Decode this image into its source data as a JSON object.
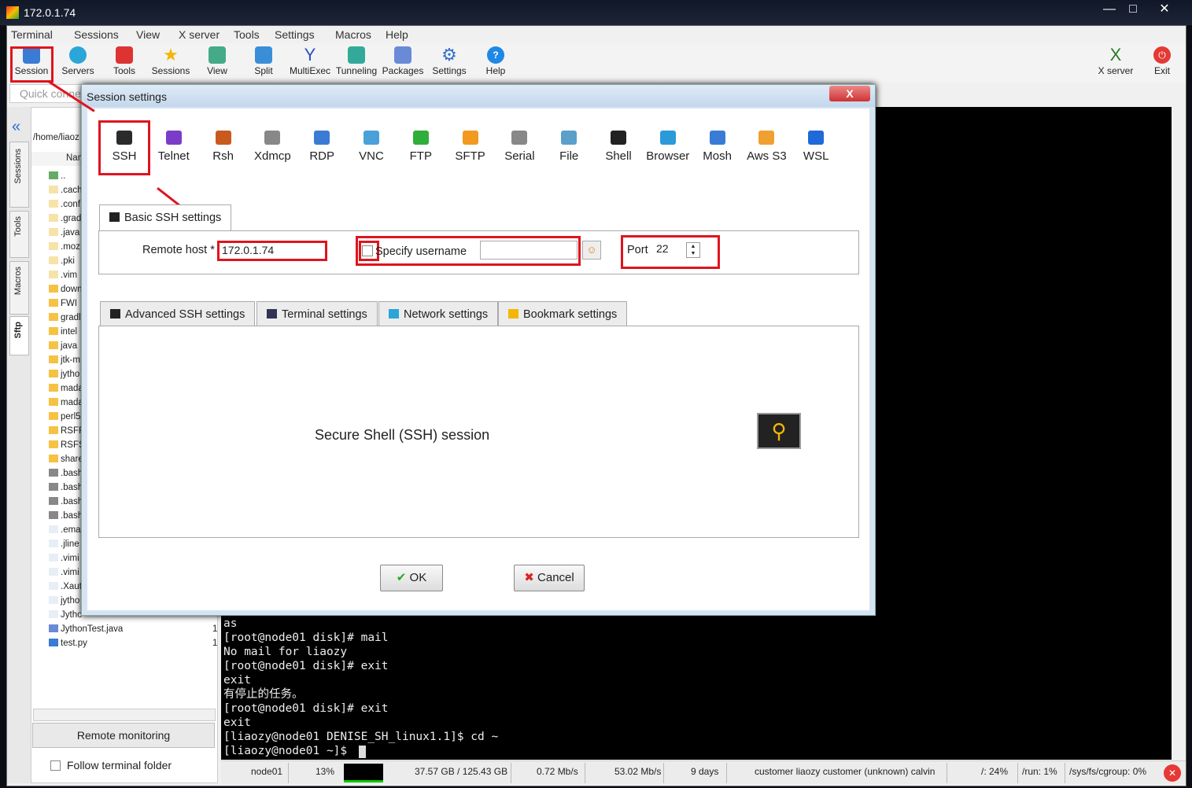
{
  "window": {
    "title": "172.0.1.74"
  },
  "menu": [
    "Terminal",
    "Sessions",
    "View",
    "X server",
    "Tools",
    "Settings",
    "Macros",
    "Help"
  ],
  "toolbar": [
    {
      "label": "Session",
      "icon": "monitor-session-icon",
      "color": "#3a7bd5"
    },
    {
      "label": "Servers",
      "icon": "servers-icon",
      "color": "#2aa6d8"
    },
    {
      "label": "Tools",
      "icon": "tools-icon",
      "color": "#d33"
    },
    {
      "label": "Sessions",
      "icon": "star-icon",
      "color": "#f2b705"
    },
    {
      "label": "View",
      "icon": "view-icon",
      "color": "#4a8"
    },
    {
      "label": "Split",
      "icon": "split-icon",
      "color": "#3a8ed8"
    },
    {
      "label": "MultiExec",
      "icon": "multiexec-icon",
      "color": "#3050c0"
    },
    {
      "label": "Tunneling",
      "icon": "tunneling-icon",
      "color": "#3a9"
    },
    {
      "label": "Packages",
      "icon": "packages-icon",
      "color": "#6a8ad8"
    },
    {
      "label": "Settings",
      "icon": "gear-icon",
      "color": "#3070c8"
    },
    {
      "label": "Help",
      "icon": "help-icon",
      "color": "#1e88e5"
    }
  ],
  "toolbar_right": [
    {
      "label": "X server",
      "icon": "x-server-icon"
    },
    {
      "label": "Exit",
      "icon": "power-icon"
    }
  ],
  "quick_connect": {
    "placeholder": "Quick conne"
  },
  "side_tabs": [
    "Sessions",
    "Tools",
    "Macros",
    "Sftp"
  ],
  "files": {
    "path": "/home/liaoz",
    "column": "Name",
    "items": [
      {
        "name": "..",
        "type": "up"
      },
      {
        "name": ".cach",
        "type": "hidden-folder"
      },
      {
        "name": ".conf",
        "type": "hidden-folder"
      },
      {
        "name": ".grad",
        "type": "hidden-folder"
      },
      {
        "name": ".java",
        "type": "hidden-folder"
      },
      {
        "name": ".moz",
        "type": "hidden-folder"
      },
      {
        "name": ".pki",
        "type": "hidden-folder"
      },
      {
        "name": ".vim",
        "type": "hidden-folder"
      },
      {
        "name": "down",
        "type": "folder"
      },
      {
        "name": "FWI",
        "type": "folder"
      },
      {
        "name": "gradl",
        "type": "folder"
      },
      {
        "name": "intel",
        "type": "folder"
      },
      {
        "name": "java",
        "type": "folder"
      },
      {
        "name": "jtk-m",
        "type": "folder"
      },
      {
        "name": "jytho",
        "type": "folder"
      },
      {
        "name": "mada",
        "type": "folder"
      },
      {
        "name": "mada",
        "type": "folder"
      },
      {
        "name": "perl5",
        "type": "folder"
      },
      {
        "name": "RSFR",
        "type": "folder"
      },
      {
        "name": "RSFS",
        "type": "folder"
      },
      {
        "name": "share",
        "type": "folder"
      },
      {
        "name": ".bash",
        "type": "file-dark"
      },
      {
        "name": ".bash",
        "type": "file-dark"
      },
      {
        "name": ".bash",
        "type": "file-dark"
      },
      {
        "name": ".bash",
        "type": "file-dark"
      },
      {
        "name": ".ema",
        "type": "file"
      },
      {
        "name": ".jline",
        "type": "file"
      },
      {
        "name": ".vimi",
        "type": "file"
      },
      {
        "name": ".vimi",
        "type": "file"
      },
      {
        "name": ".Xaut",
        "type": "file"
      },
      {
        "name": "jytho",
        "type": "file"
      },
      {
        "name": "Jytho",
        "type": "file"
      },
      {
        "name": "JythonTest.java",
        "type": "java",
        "size": "1"
      },
      {
        "name": "test.py",
        "type": "python",
        "size": "1"
      }
    ]
  },
  "remote_monitoring": "Remote monitoring",
  "follow_terminal": "Follow terminal folder",
  "terminal": [
    "as",
    "[root@node01 disk]# mail",
    "No mail for liaozy",
    "[root@node01 disk]# exit",
    "exit",
    "有停止的任务。",
    "[root@node01 disk]# exit",
    "exit",
    "[liaozy@node01 DENISE_SH_linux1.1]$ cd ~",
    "[liaozy@node01 ~]$ "
  ],
  "status": {
    "host": "node01",
    "cpu": "13%",
    "memory": "37.57 GB / 125.43 GB",
    "upload": "0.72 Mb/s",
    "download": "53.02 Mb/s",
    "uptime": "9 days",
    "users": "customer  liaozy  customer  (unknown)  calvin",
    "disk_root": "/: 24%",
    "disk_run": "/run: 1%",
    "disk_cgroup": "/sys/fs/cgroup: 0%"
  },
  "dialog": {
    "title": "Session settings",
    "close": "X",
    "protocols": [
      {
        "label": "SSH",
        "color": "#2b2b2b"
      },
      {
        "label": "Telnet",
        "color": "#7a3cc8"
      },
      {
        "label": "Rsh",
        "color": "#c85a1e"
      },
      {
        "label": "Xdmcp",
        "color": "#888"
      },
      {
        "label": "RDP",
        "color": "#3a7bd5"
      },
      {
        "label": "VNC",
        "color": "#4aa0d8"
      },
      {
        "label": "FTP",
        "color": "#2fae3a"
      },
      {
        "label": "SFTP",
        "color": "#f39a1e"
      },
      {
        "label": "Serial",
        "color": "#888"
      },
      {
        "label": "File",
        "color": "#5aa0c8"
      },
      {
        "label": "Shell",
        "color": "#222"
      },
      {
        "label": "Browser",
        "color": "#2a9ad8"
      },
      {
        "label": "Mosh",
        "color": "#3a7bd5"
      },
      {
        "label": "Aws S3",
        "color": "#f0a030"
      },
      {
        "label": "WSL",
        "color": "#1e6ad8"
      }
    ],
    "basic_tab": "Basic SSH settings",
    "remote_host_label": "Remote host *",
    "remote_host": "172.0.1.74",
    "specify_username": "Specify username",
    "username": "",
    "port_label": "Port",
    "port": "22",
    "tabs": [
      "Advanced SSH settings",
      "Terminal settings",
      "Network settings",
      "Bookmark settings"
    ],
    "description": "Secure Shell (SSH) session",
    "ok": "OK",
    "cancel": "Cancel"
  }
}
